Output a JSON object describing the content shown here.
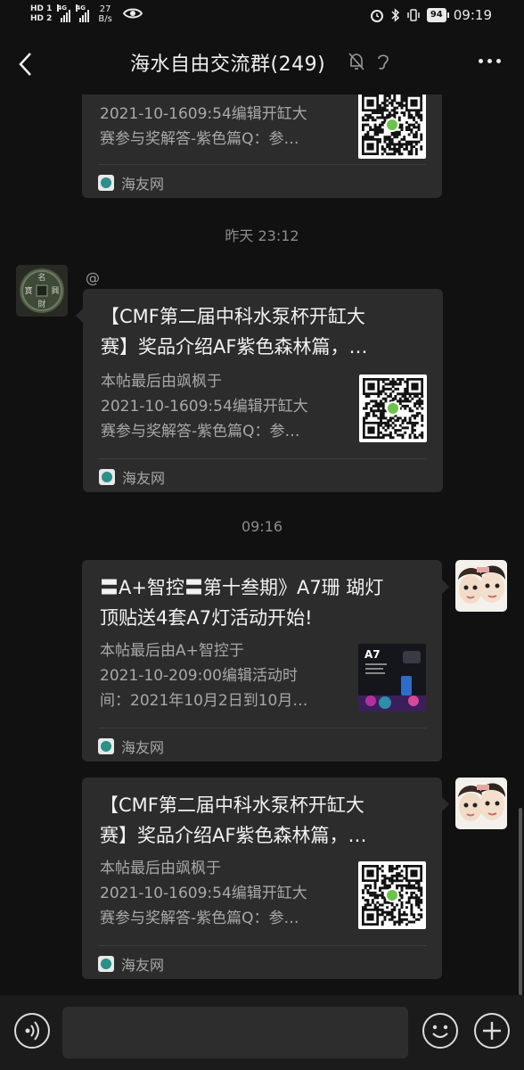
{
  "status_bar": {
    "hd1": "HD 1",
    "hd2": "HD 2",
    "net1": "4G",
    "net2": "4G",
    "speed_value": "27",
    "speed_unit": "B/s",
    "battery": "94",
    "time": "09:19"
  },
  "header": {
    "title": "海水自由交流群(249)",
    "icons": [
      "back-icon",
      "mute-icon",
      "ear-icon",
      "more-icon"
    ]
  },
  "messages": [
    {
      "side": "left",
      "title_line": "",
      "desc": [
        "2021-10-1609:54编辑开缸大",
        "赛参与奖解答-紫色篇Q：参…"
      ],
      "source": "海友网",
      "thumb": "qr-code"
    },
    {
      "timestamp": "昨天 23:12"
    },
    {
      "side": "left",
      "mention": "@",
      "title": [
        "【CMF第二届中科水泵杯开缸大",
        "赛】奖品介绍AF紫色森林篇，…"
      ],
      "desc": [
        "本帖最后由飒枫于",
        "2021-10-1609:54编辑开缸大",
        "赛参与奖解答-紫色篇Q：参…"
      ],
      "source": "海友网",
      "thumb": "qr-code"
    },
    {
      "timestamp": "09:16"
    },
    {
      "side": "right",
      "title": [
        "〓A+智控〓第十叁期》A7珊 瑚灯",
        "顶贴送4套A7灯活动开始!"
      ],
      "desc": [
        "本帖最后由A+智控于",
        "2021-10-209:00编辑活动时",
        "间：2021年10月2日到10月…"
      ],
      "source": "海友网",
      "thumb": "a7-lamp-poster",
      "thumb_text": "A7"
    },
    {
      "side": "right",
      "title": [
        "【CMF第二届中科水泵杯开缸大",
        "赛】奖品介绍AF紫色森林篇，…"
      ],
      "desc": [
        "本帖最后由飒枫于",
        "2021-10-1609:54编辑开缸大",
        "赛参与奖解答-紫色篇Q：参…"
      ],
      "source": "海友网",
      "thumb": "qr-code"
    }
  ],
  "input_bar": {
    "placeholder": "",
    "icons": [
      "voice-icon",
      "emoji-icon",
      "plus-icon"
    ]
  },
  "colors": {
    "background": "#111111",
    "card": "#2c2c2c",
    "text": "#f2f2f2",
    "muted": "#a8a8a8",
    "source_icon": "#2b8f8a"
  }
}
